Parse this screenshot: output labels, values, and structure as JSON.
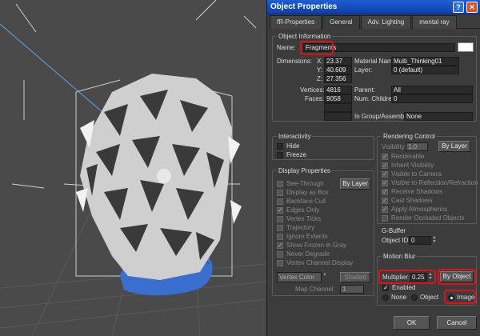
{
  "dialog": {
    "title": "Object Properties",
    "title_buttons": {
      "help": "?",
      "close": "✕"
    },
    "tabs": [
      "fR-Properties",
      "General",
      "Adv. Lighting",
      "mental ray"
    ],
    "active_tab": 1
  },
  "object_info": {
    "group_title": "Object Information",
    "name_label": "Name:",
    "name_value": "Fragments",
    "dimensions_label": "Dimensions:",
    "x_label": "X:",
    "x_value": "23.37",
    "y_label": "Y:",
    "y_value": "40.609",
    "z_label": "Z:",
    "z_value": "27.356",
    "material_label": "Material Name:",
    "material_value": "Multi_Thinking01",
    "layer_label": "Layer:",
    "layer_value": "0 (default)",
    "vertices_label": "Vertices:",
    "vertices_value": "4816",
    "faces_label": "Faces:",
    "faces_value": "9058",
    "parent_label": "Parent:",
    "parent_value": "All",
    "children_label": "Num. Children:",
    "children_value": "0",
    "group_label": "In Group/Assembly:",
    "group_value": "None"
  },
  "interactivity": {
    "group_title": "Interactivity",
    "hide": "Hide",
    "freeze": "Freeze"
  },
  "display_properties": {
    "group_title": "Display Properties",
    "by_layer": "By Layer",
    "items": [
      "See-Through",
      "Display as Box",
      "Backface Cull",
      "Edges Only",
      "Vertex Ticks",
      "Trajectory",
      "Ignore Extents",
      "Show Frozen in Gray",
      "Never Degrade",
      "Vertex Channel Display"
    ],
    "vertex_color": "Vertex Color",
    "shaded": "Shaded",
    "map_channel_label": "Map Channel:",
    "map_channel_value": "1"
  },
  "rendering_control": {
    "group_title": "Rendering Control",
    "visibility_label": "Visibility:",
    "visibility_value": "1.0",
    "by_layer": "By Layer",
    "items": [
      "Renderable",
      "Inherit Visibility",
      "Visible to Camera",
      "Visible to Reflection/Refraction",
      "Receive Shadows",
      "Cast Shadows",
      "Apply Atmospherics",
      "Render Occluded Objects"
    ]
  },
  "gbuffer": {
    "title": "G-Buffer",
    "object_id_label": "Object ID:",
    "object_id_value": "0"
  },
  "motion_blur": {
    "group_title": "Motion Blur",
    "multiplier_label": "Multiplier:",
    "multiplier_value": "0.25",
    "by_object": "By Object",
    "enabled": "Enabled",
    "options": [
      "None",
      "Object",
      "Image"
    ],
    "selected": 2
  },
  "footer": {
    "ok": "OK",
    "cancel": "Cancel"
  },
  "colors": {
    "title_bar": "#1f5fd0",
    "dialog_bg": "#3c3c3c",
    "highlight": "#e0101a",
    "object_blue": "#3a6fd0"
  }
}
